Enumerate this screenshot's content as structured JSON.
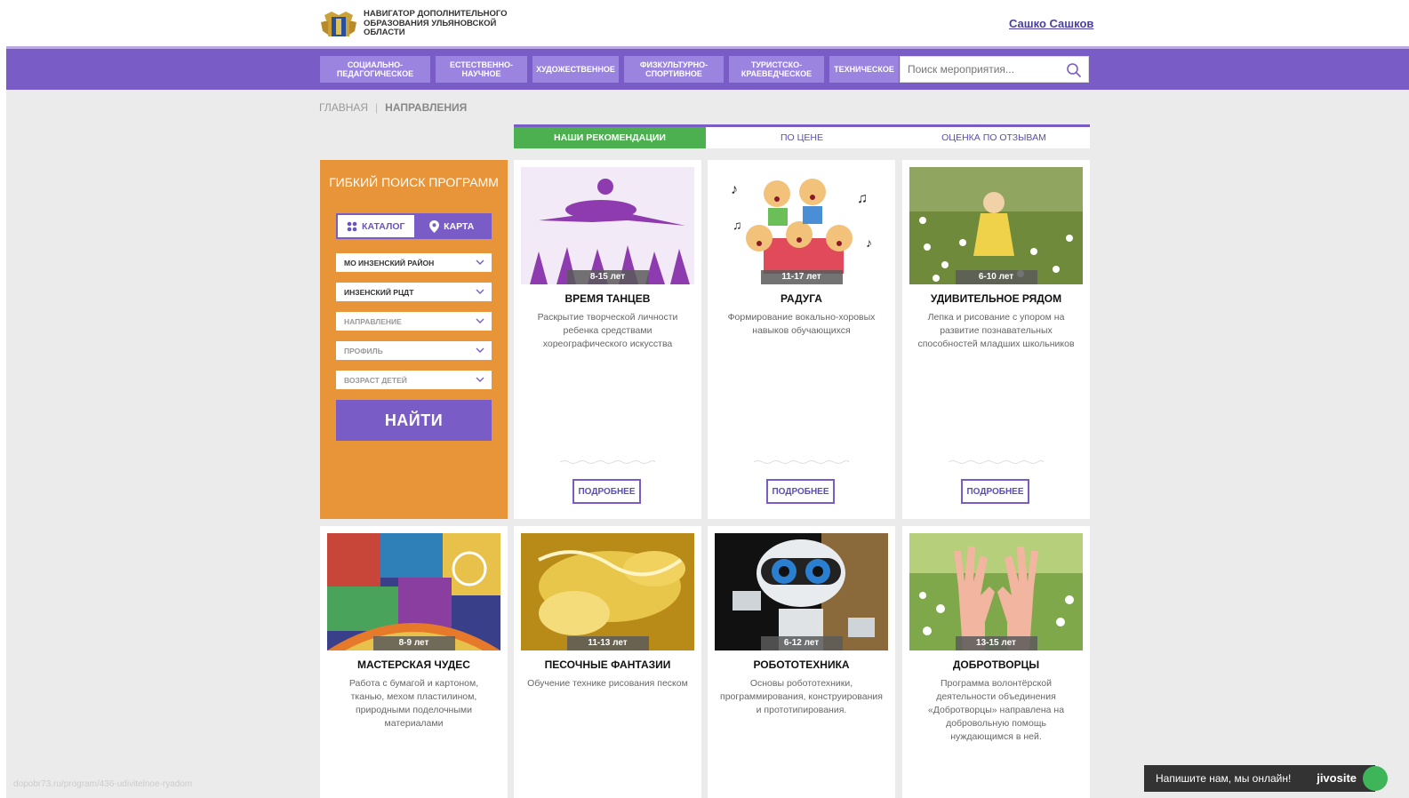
{
  "header": {
    "logo_text": "Навигатор дополнительного образования Ульяновской области",
    "user_name": "Сашко Сашков"
  },
  "nav": {
    "items": [
      {
        "label": "Социально-педагогическое"
      },
      {
        "label": "Естественно-научное"
      },
      {
        "label": "Художественное"
      },
      {
        "label": "Физкультурно-спортивное"
      },
      {
        "label": "Туристско-краеведческое"
      },
      {
        "label": "Техническое"
      }
    ],
    "search_placeholder": "Поиск мероприятия..."
  },
  "breadcrumb": {
    "home": "Главная",
    "separator": "|",
    "current": "Направления"
  },
  "tabs": [
    {
      "label": "Наши рекомендации",
      "active": true
    },
    {
      "label": "По цене",
      "active": false
    },
    {
      "label": "Оценка по отзывам",
      "active": false
    }
  ],
  "filter": {
    "title": "Гибкий поиск программ",
    "catalog_label": "Каталог",
    "map_label": "Карта",
    "selects": [
      {
        "value": "МО Инзенский район"
      },
      {
        "value": "Инзенский РЦДТ"
      },
      {
        "value": "Направление"
      },
      {
        "value": "Профиль"
      },
      {
        "value": "Возраст детей"
      }
    ],
    "find_label": "Найти"
  },
  "cards": [
    {
      "age": "8-15 лет",
      "title": "Время танцев",
      "desc": "Раскрытие творческой личности ребенка средствами хореографического искусства",
      "more": "Подробнее"
    },
    {
      "age": "11-17 лет",
      "title": "Радуга",
      "desc": "Формирование вокально-хоровых навыков обучающихся",
      "more": "Подробнее"
    },
    {
      "age": "6-10 лет",
      "title": "Удивительное рядом",
      "desc": "Лепка и рисование с упором на развитие познавательных способностей младших школьников",
      "more": "Подробнее"
    },
    {
      "age": "8-9 лет",
      "title": "Мастерская чудес",
      "desc": "Работа с бумагой и картоном, тканью, мехом пластилином, природными поделочными материалами"
    },
    {
      "age": "11-13 лет",
      "title": "Песочные фантазии",
      "desc": "Обучение технике рисования песком"
    },
    {
      "age": "6-12 лет",
      "title": "Робототехника",
      "desc": "Основы робототехники, программирования, конструирования и прототипирования."
    },
    {
      "age": "13-15 лет",
      "title": "Добротворцы",
      "desc": "Программа волонтёрской деятельности объединения «Добротворцы» направлена на добровольную помощь нуждающимся в ней."
    }
  ],
  "status_url": "dopobr73.ru/program/436-udivitelnoe-ryadom",
  "chat": {
    "text": "Напишите нам, мы онлайн!",
    "brand": "jivosite"
  },
  "colors": {
    "accent_purple": "#7a5cc6",
    "filter_orange": "#e8953a",
    "active_tab_green": "#4cb050"
  }
}
